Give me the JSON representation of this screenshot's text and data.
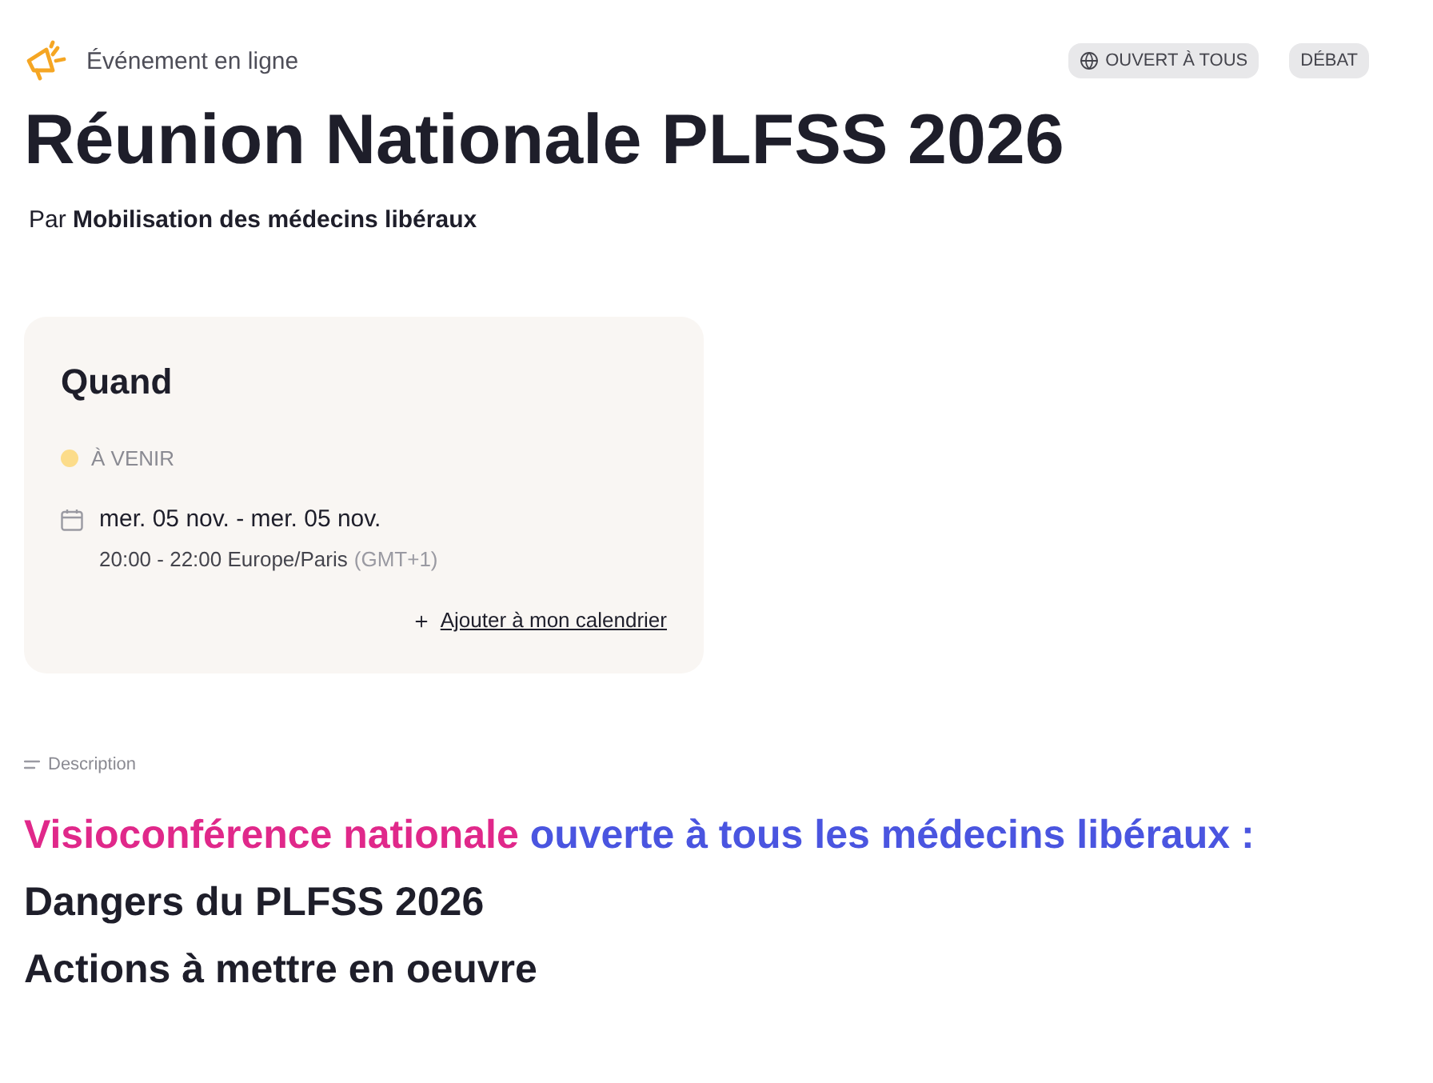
{
  "event_type": {
    "label": "Événement en ligne"
  },
  "badges": [
    {
      "kind": "access",
      "label": "OUVERT À TOUS"
    },
    {
      "kind": "category",
      "label": "DÉBAT"
    }
  ],
  "title": "Réunion Nationale PLFSS 2026",
  "organizer": "Par **Mobilisation des médecins libéraux**",
  "when_card": {
    "heading": "Quand",
    "status": {
      "label": "À VENIR",
      "color": "#fcdc8a"
    },
    "date_range": "mer. 05 nov. - mer. 05 nov.",
    "time_range": "20:00 - 22:00 Europe/Paris",
    "timezone_offset": "(GMT+1)",
    "add_to_calendar": "Ajouter à mon calendrier"
  },
  "description": {
    "label": "Description",
    "lines": [
      {
        "segments": [
          {
            "text": "Visioconférence nationale",
            "color": "#e0288a"
          },
          {
            "text": "ouverte à tous les médecins libéraux :",
            "color": "#4a55e0"
          }
        ]
      },
      {
        "segments": [
          {
            "text": "Dangers du PLFSS 2026"
          }
        ]
      },
      {
        "segments": [
          {
            "text": "Actions à mettre en oeuvre"
          }
        ]
      }
    ]
  }
}
